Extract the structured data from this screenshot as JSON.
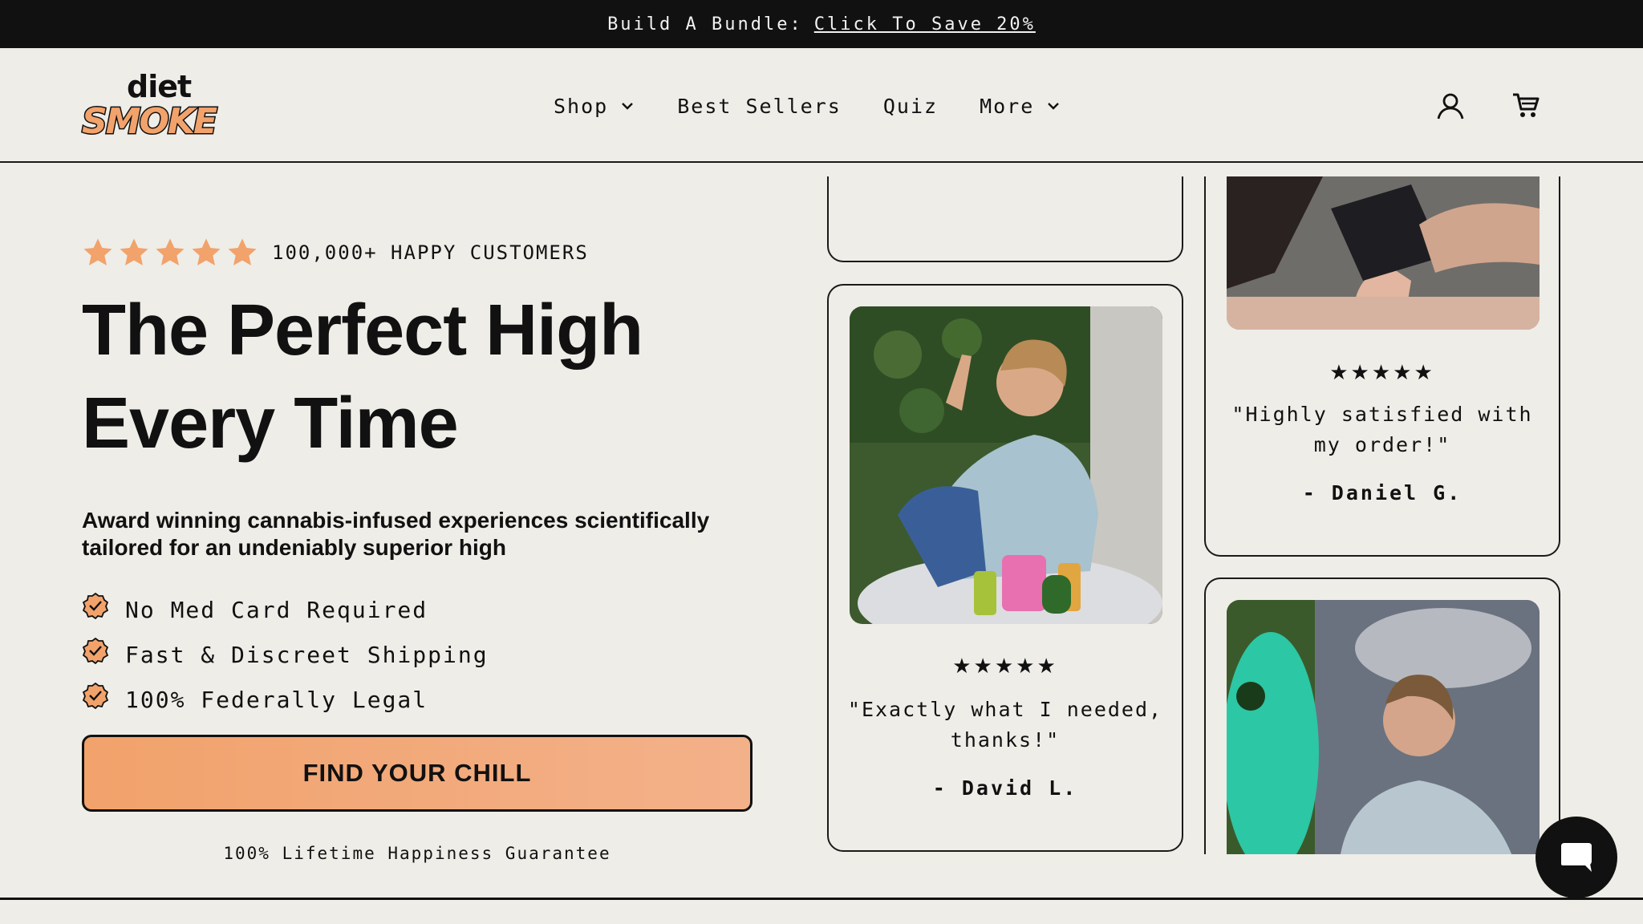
{
  "announcement": {
    "prefix": "Build A Bundle:",
    "link": "Click To Save 20%"
  },
  "header": {
    "logo_top": "diet",
    "logo_bottom": "SMOKE",
    "nav": [
      {
        "label": "Shop",
        "has_dropdown": true
      },
      {
        "label": "Best Sellers",
        "has_dropdown": false
      },
      {
        "label": "Quiz",
        "has_dropdown": false
      },
      {
        "label": "More",
        "has_dropdown": true
      }
    ],
    "icons": [
      "account-icon",
      "cart-icon"
    ]
  },
  "hero": {
    "rating_count_text": "100,000+ HAPPY CUSTOMERS",
    "rating_stars": 5,
    "title_line1": "The Perfect High",
    "title_line2": "Every Time",
    "subtitle": "Award winning cannabis-infused experiences scientifically tailored for an undeniably superior high",
    "features": [
      "No Med Card Required",
      "Fast & Discreet Shipping",
      "100% Federally Legal"
    ],
    "cta_label": "FIND YOUR CHILL",
    "guarantee": "100% Lifetime Happiness Guarantee"
  },
  "reviews": [
    {
      "stars": "★★★★★",
      "quote": "\"Exactly what I needed, thanks!\"",
      "author": "- David L."
    },
    {
      "stars": "★★★★★",
      "quote": "\"Highly satisfied with my order!\"",
      "author": "- Daniel G."
    }
  ],
  "colors": {
    "background": "#eeede8",
    "accent_orange": "#f2a26b",
    "dark": "#111111"
  }
}
